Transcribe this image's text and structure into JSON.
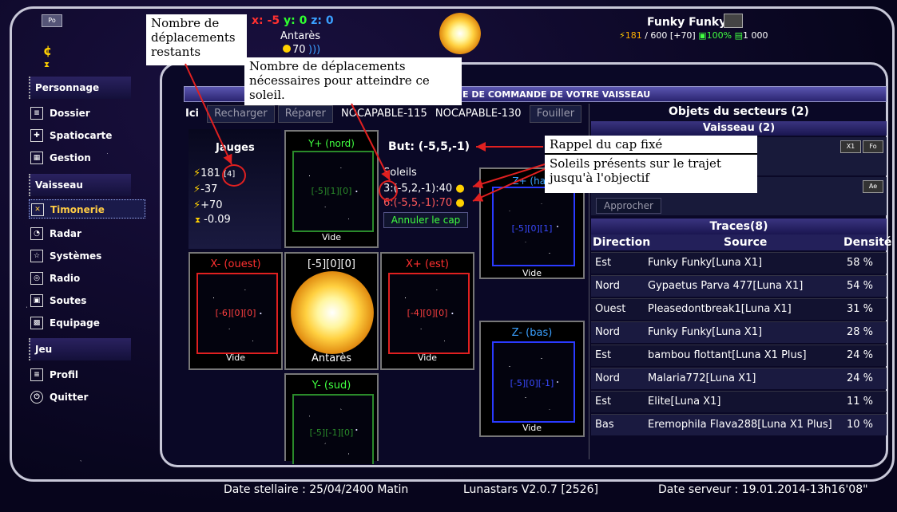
{
  "header": {
    "badge": "Po",
    "credit_icon": "¢",
    "coords": {
      "x_label": "x: ",
      "x": "-5",
      "y_label": "y: ",
      "y": "0",
      "z_label": "z: ",
      "z": "0"
    },
    "location": "Antarès",
    "fuel": "70",
    "player": "Funky Funky",
    "stats": {
      "energy": "181",
      "energy_max": "/ 600 [+70]",
      "percent": "100%",
      "cargo": "1 000"
    }
  },
  "sidebar": {
    "sections": [
      {
        "title": "Personnage",
        "items": [
          "Dossier",
          "Spatiocarte",
          "Gestion"
        ]
      },
      {
        "title": "Vaisseau",
        "items": [
          "Timonerie",
          "Radar",
          "Systèmes",
          "Radio",
          "Soutes",
          "Equipage"
        ]
      },
      {
        "title": "Jeu",
        "items": [
          "Profil",
          "Quitter"
        ]
      }
    ]
  },
  "panel": {
    "title": "E DE COMMANDE DE VOTRE VAISSEAU"
  },
  "toolbar": {
    "ici": "Ici",
    "reload": "Recharger",
    "repair": "Réparer",
    "ship1": "NOCAPABLE-115",
    "ship2": "NOCAPABLE-130",
    "search": "Fouiller"
  },
  "gauges": {
    "title": "Jauges",
    "v1": "181",
    "v1_extra": "[4]",
    "v2": "-37",
    "v3": "+70",
    "v4": "-0.09"
  },
  "goal": {
    "label": "But: (-5,5,-1)",
    "suns_label": "Soleils",
    "sun1": "3:(-5,2,-1):40",
    "sun2": "6:(-5,5,-1):70",
    "cancel": "Annuler le cap"
  },
  "grid": {
    "north": {
      "label": "Y+ (nord)",
      "coord": "[-5][1][0]",
      "status": "Vide"
    },
    "west": {
      "label": "X- (ouest)",
      "coord": "[-6][0][0]",
      "status": "Vide"
    },
    "center": {
      "label": "[-5][0][0]",
      "status": "Antarès"
    },
    "east": {
      "label": "X+ (est)",
      "coord": "[-4][0][0]",
      "status": "Vide"
    },
    "south": {
      "label": "Y- (sud)",
      "coord": "[-5][-1][0]"
    },
    "up": {
      "label": "Z+ (hau",
      "coord": "[-5][0][1]",
      "status": "Vide"
    },
    "down": {
      "label": "Z- (bas)",
      "coord": "[-5][0][-1]",
      "status": "Vide"
    }
  },
  "objects": {
    "title": "Objets du secteurs (2)",
    "sub": "Vaisseau (2)",
    "b1": "X1",
    "b2": "Fo",
    "b3": "Ae",
    "approach": "Approcher"
  },
  "traces": {
    "title": "Traces(8)",
    "headers": [
      "Direction",
      "Source",
      "Densité"
    ],
    "rows": [
      [
        "Est",
        "Funky Funky[Luna X1]",
        "58 %"
      ],
      [
        "Nord",
        "Gypaetus Parva 477[Luna X1]",
        "54 %"
      ],
      [
        "Ouest",
        "Pleasedontbreak1[Luna X1]",
        "31 %"
      ],
      [
        "Nord",
        "Funky Funky[Luna X1]",
        "28 %"
      ],
      [
        "Est",
        "bambou flottant[Luna X1 Plus]",
        "24 %"
      ],
      [
        "Nord",
        "Malaria772[Luna X1]",
        "24 %"
      ],
      [
        "Est",
        "Elite[Luna X1]",
        "11 %"
      ],
      [
        "Bas",
        "Eremophila Flava288[Luna X1 Plus]",
        "10 %"
      ]
    ]
  },
  "annotations": {
    "a1": "Nombre de déplacements restants",
    "a2": "Nombre de déplacements nécessaires pour atteindre ce soleil.",
    "a3": "Rappel du cap fixé",
    "a4": "Soleils présents sur le trajet jusqu'à l'objectif"
  },
  "footer": {
    "date": "Date stellaire : 25/04/2400 Matin",
    "version": "Lunastars V2.0.7 [2526]",
    "server": "Date serveur : 19.01.2014-13h16'08\""
  }
}
